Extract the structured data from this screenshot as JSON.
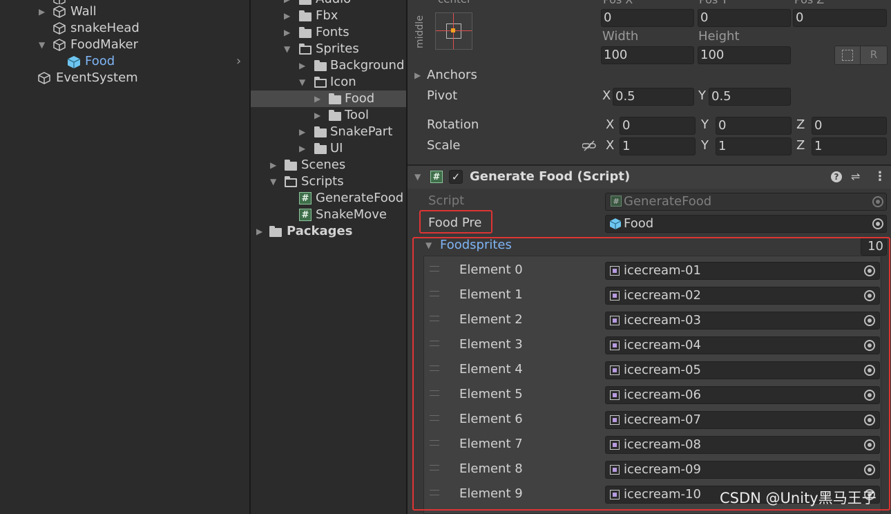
{
  "hierarchy": {
    "items": [
      {
        "label": "Wall",
        "expanded": false
      },
      {
        "label": "snakeHead"
      },
      {
        "label": "FoodMaker",
        "expanded": true
      },
      {
        "label": "Food",
        "selected": true
      },
      {
        "label": "EventSystem"
      }
    ]
  },
  "project": {
    "items": [
      {
        "label": "Audio"
      },
      {
        "label": "Fbx"
      },
      {
        "label": "Fonts"
      },
      {
        "label": "Sprites"
      },
      {
        "label": "Background"
      },
      {
        "label": "Icon"
      },
      {
        "label": "Food"
      },
      {
        "label": "Tool"
      },
      {
        "label": "SnakePart"
      },
      {
        "label": "UI"
      },
      {
        "label": "Scenes"
      },
      {
        "label": "Scripts"
      },
      {
        "label": "GenerateFood"
      },
      {
        "label": "SnakeMove"
      },
      {
        "label": "Packages"
      }
    ]
  },
  "rect_transform": {
    "anchor_top_label": "center",
    "anchor_side_label": "middle",
    "pos_x_label": "Pos X",
    "pos_y_label": "Pos Y",
    "pos_z_label": "Pos Z",
    "pos_x": "0",
    "pos_y": "0",
    "pos_z": "0",
    "width_label": "Width",
    "height_label": "Height",
    "width": "100",
    "height": "100",
    "raw_button": "R",
    "anchors_label": "Anchors",
    "pivot_label": "Pivot",
    "pivot_x": "0.5",
    "pivot_y": "0.5",
    "rotation_label": "Rotation",
    "rotation_x": "0",
    "rotation_y": "0",
    "rotation_z": "0",
    "scale_label": "Scale",
    "scale_x": "1",
    "scale_y": "1",
    "scale_z": "1",
    "axis_x": "X",
    "axis_y": "Y",
    "axis_z": "Z"
  },
  "component": {
    "title": "Generate Food (Script)",
    "script_label": "Script",
    "script_value": "GenerateFood",
    "food_pre_label": "Food Pre",
    "food_pre_value": "Food",
    "array_label": "Foodsprites",
    "array_size": "10",
    "elements": [
      {
        "label": "Element 0",
        "value": "icecream-01"
      },
      {
        "label": "Element 1",
        "value": "icecream-02"
      },
      {
        "label": "Element 2",
        "value": "icecream-03"
      },
      {
        "label": "Element 3",
        "value": "icecream-04"
      },
      {
        "label": "Element 4",
        "value": "icecream-05"
      },
      {
        "label": "Element 5",
        "value": "icecream-06"
      },
      {
        "label": "Element 6",
        "value": "icecream-07"
      },
      {
        "label": "Element 7",
        "value": "icecream-08"
      },
      {
        "label": "Element 8",
        "value": "icecream-09"
      },
      {
        "label": "Element 9",
        "value": "icecream-10"
      }
    ]
  },
  "watermark": "CSDN @Unity黑马王子",
  "colors": {
    "highlight_red": "#e03434",
    "selected_blue": "#7fb5f5",
    "script_green": "#3f6e4a"
  }
}
